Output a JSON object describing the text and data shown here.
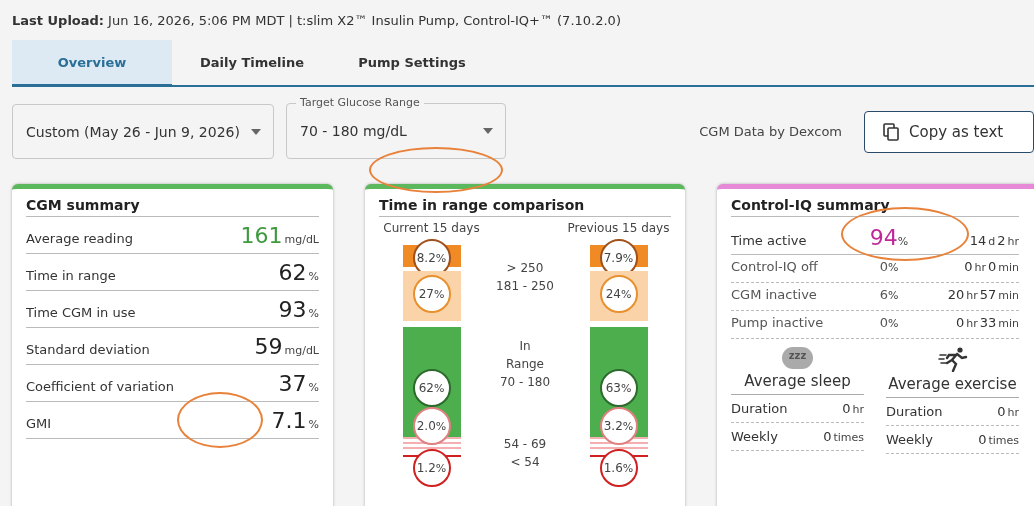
{
  "upload": {
    "label": "Last Upload:",
    "text": "Jun 16, 2026, 5:06 PM MDT | t:slim X2™ Insulin Pump, Control-IQ+™ (7.10.2.0)"
  },
  "tabs": [
    {
      "label": "Overview",
      "selected": true
    },
    {
      "label": "Daily Timeline",
      "selected": false
    },
    {
      "label": "Pump Settings",
      "selected": false
    }
  ],
  "date_select": {
    "value": "Custom (May 26 - Jun 9, 2026)"
  },
  "range_select": {
    "label": "Target Glucose Range",
    "value": "70 - 180 mg/dL"
  },
  "cgm_source": "CGM Data by Dexcom",
  "copy_button": {
    "label": "Copy as text"
  },
  "cgm_summary": {
    "title": "CGM summary",
    "rows": [
      {
        "label": "Average reading",
        "value": "161",
        "unit": "mg/dL",
        "color": "#3d9a3d",
        "highlight": false
      },
      {
        "label": "Time in range",
        "value": "62",
        "unit": "%",
        "color": "#222222",
        "highlight": false
      },
      {
        "label": "Time CGM in use",
        "value": "93",
        "unit": "%",
        "color": "#222222",
        "highlight": false
      },
      {
        "label": "Standard deviation",
        "value": "59",
        "unit": "mg/dL",
        "color": "#222222",
        "highlight": false
      },
      {
        "label": "Coefficient of variation",
        "value": "37",
        "unit": "%",
        "color": "#222222",
        "highlight": false
      },
      {
        "label": "GMI",
        "value": "7.1",
        "unit": "%",
        "color": "#222222",
        "highlight": true
      }
    ]
  },
  "tir": {
    "title": "Time in range comparison",
    "highlight": true,
    "columns": [
      {
        "title": "Current 15 days",
        "segments": [
          {
            "kind": "very_high",
            "value": "8.2",
            "unit": "%"
          },
          {
            "kind": "high",
            "value": "27",
            "unit": "%"
          },
          {
            "kind": "in_range",
            "value": "62",
            "unit": "%"
          },
          {
            "kind": "low",
            "value": "2.0",
            "unit": "%"
          },
          {
            "kind": "very_low",
            "value": "1.2",
            "unit": "%"
          }
        ]
      },
      {
        "title": "Previous 15 days",
        "segments": [
          {
            "kind": "very_high",
            "value": "7.9",
            "unit": "%"
          },
          {
            "kind": "high",
            "value": "24",
            "unit": "%"
          },
          {
            "kind": "in_range",
            "value": "63",
            "unit": "%"
          },
          {
            "kind": "low",
            "value": "3.2",
            "unit": "%"
          },
          {
            "kind": "very_low",
            "value": "1.6",
            "unit": "%"
          }
        ]
      }
    ],
    "range_labels": [
      {
        "lines": [
          "> 250",
          "181 - 250"
        ]
      },
      {
        "lines": [
          "In",
          "Range",
          "70 - 180"
        ]
      },
      {
        "lines": [
          "54 - 69",
          "< 54"
        ]
      }
    ]
  },
  "control_iq": {
    "title": "Control-IQ summary",
    "rows": [
      {
        "kind": "main",
        "label": "Time active",
        "percent": "94",
        "unit": "%",
        "highlight": true,
        "duration": [
          {
            "n": "14",
            "u": "d"
          },
          {
            "n": "2",
            "u": "hr"
          }
        ]
      },
      {
        "kind": "detail",
        "label": "Control-IQ off",
        "percent": "0",
        "unit": "%",
        "highlight": false,
        "duration": [
          {
            "n": "0",
            "u": "hr"
          },
          {
            "n": "0",
            "u": "min"
          }
        ]
      },
      {
        "kind": "detail",
        "label": "CGM inactive",
        "percent": "6",
        "unit": "%",
        "highlight": false,
        "duration": [
          {
            "n": "20",
            "u": "hr"
          },
          {
            "n": "57",
            "u": "min"
          }
        ]
      },
      {
        "kind": "detail",
        "label": "Pump inactive",
        "percent": "0",
        "unit": "%",
        "highlight": false,
        "duration": [
          {
            "n": "0",
            "u": "hr"
          },
          {
            "n": "33",
            "u": "min"
          }
        ]
      }
    ],
    "activities": [
      {
        "kind": "sleep",
        "icon_text": "zzz",
        "title": "Average sleep",
        "rows": [
          {
            "label": "Duration",
            "n": "0",
            "u": "hr"
          },
          {
            "label": "Weekly",
            "n": "0",
            "u": "times"
          }
        ]
      },
      {
        "kind": "exercise",
        "title": "Average exercise",
        "rows": [
          {
            "label": "Duration",
            "n": "0",
            "u": "hr"
          },
          {
            "label": "Weekly",
            "n": "0",
            "u": "times"
          }
        ]
      }
    ]
  }
}
